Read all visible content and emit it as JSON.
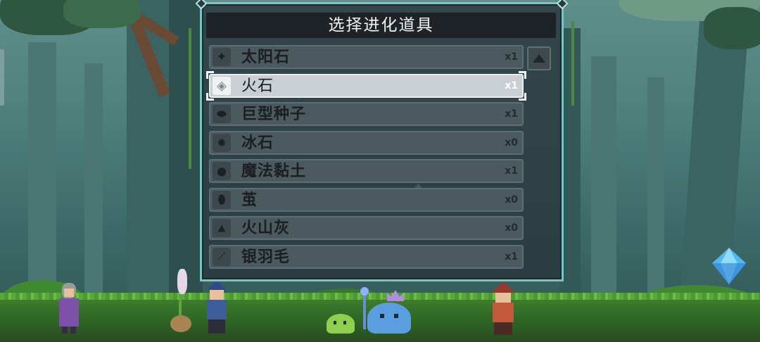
{
  "panel": {
    "title": "选择进化道具",
    "items": [
      {
        "name": "太阳石",
        "qty": "x1",
        "icon": "sun-stone-icon",
        "selected": false
      },
      {
        "name": "火石",
        "qty": "x1",
        "icon": "fire-stone-icon",
        "selected": true
      },
      {
        "name": "巨型种子",
        "qty": "x1",
        "icon": "giant-seed-icon",
        "selected": false
      },
      {
        "name": "冰石",
        "qty": "x0",
        "icon": "ice-stone-icon",
        "selected": false
      },
      {
        "name": "魔法黏土",
        "qty": "x1",
        "icon": "magic-clay-icon",
        "selected": false
      },
      {
        "name": "茧",
        "qty": "x0",
        "icon": "cocoon-icon",
        "selected": false
      },
      {
        "name": "火山灰",
        "qty": "x0",
        "icon": "volcanic-ash-icon",
        "selected": false
      },
      {
        "name": "银羽毛",
        "qty": "x1",
        "icon": "silver-feather-icon",
        "selected": false
      }
    ],
    "scroll_icon": "scroll-up-icon"
  },
  "scene": {
    "characters": [
      "old-woman-npc",
      "potato-monster",
      "blue-hat-keeper",
      "green-slime-monster",
      "blue-crowned-slime-monster",
      "red-hat-keeper"
    ],
    "crystal_icon": "blue-crystal-icon"
  },
  "colors": {
    "panel_border": "#79c3c0",
    "title_bar": "#1d2327",
    "row_bg": "#4a5a5f",
    "row_selected_bg": "#c9cfd2"
  }
}
